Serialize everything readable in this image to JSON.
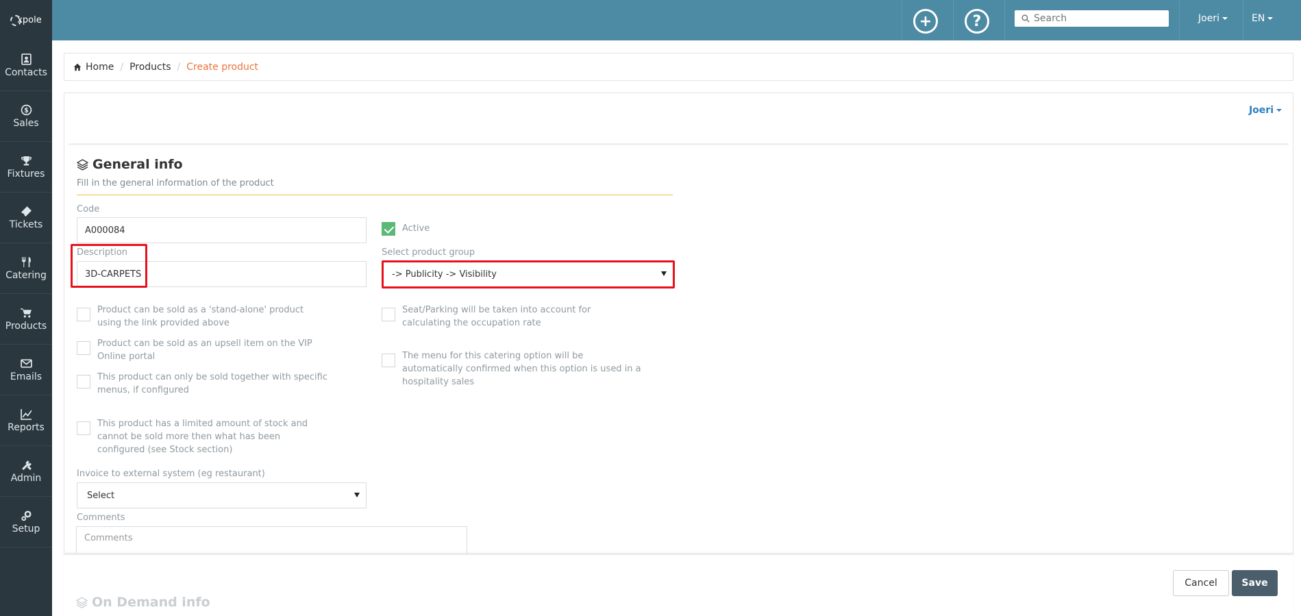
{
  "app": {
    "logo_text": "xpole"
  },
  "sidebar": {
    "items": [
      {
        "label": "Contacts",
        "icon": "contacts-icon"
      },
      {
        "label": "Sales",
        "icon": "dollar-icon"
      },
      {
        "label": "Fixtures",
        "icon": "trophy-icon"
      },
      {
        "label": "Tickets",
        "icon": "ticket-icon"
      },
      {
        "label": "Catering",
        "icon": "cutlery-icon"
      },
      {
        "label": "Products",
        "icon": "cart-icon"
      },
      {
        "label": "Emails",
        "icon": "envelope-icon"
      },
      {
        "label": "Reports",
        "icon": "chart-icon"
      },
      {
        "label": "Admin",
        "icon": "tools-icon"
      },
      {
        "label": "Setup",
        "icon": "cogs-icon"
      }
    ]
  },
  "topbar": {
    "add_icon": "plus-circle-icon",
    "help_icon": "question-circle-icon",
    "search_placeholder": "Search",
    "user": "Joeri",
    "language": "EN"
  },
  "breadcrumb": {
    "home": "Home",
    "products": "Products",
    "current": "Create product"
  },
  "panel": {
    "owner": "Joeri",
    "section_title": "General info",
    "section_subtitle": "Fill in the general information of the product",
    "code_label": "Code",
    "code_value": "A000084",
    "active_label": "Active",
    "active_checked": true,
    "description_label": "Description",
    "description_value": "3D-CARPETS",
    "product_group_label": "Select product group",
    "product_group_value": "-> Publicity -> Visibility",
    "left_checks": [
      "Product can be sold as a 'stand-alone' product using the link provided above",
      "Product can be sold as an upsell item on the VIP Online portal",
      "This product can only be sold together with specific menus, if configured",
      "This product has a limited amount of stock and cannot be sold more then what has been configured (see Stock section)"
    ],
    "right_checks": [
      "Seat/Parking will be taken into account for calculating the occupation rate",
      "The menu for this catering option will be automatically confirmed when this option is used in a hospitality sales"
    ],
    "invoice_label": "Invoice to external system (eg restaurant)",
    "invoice_value": "Select",
    "comments_label": "Comments",
    "comments_placeholder": "Comments",
    "next_section_title": "On Demand info"
  },
  "footer": {
    "cancel": "Cancel",
    "save": "Save"
  },
  "colors": {
    "sidebar_bg": "#2b373e",
    "topbar_bg": "#4d8aa3",
    "accent_orange": "#e8743b",
    "link_blue": "#2a7fc4",
    "active_green": "#5cb877",
    "highlight_red": "#e8111b",
    "save_bg": "#4a5e6b"
  }
}
